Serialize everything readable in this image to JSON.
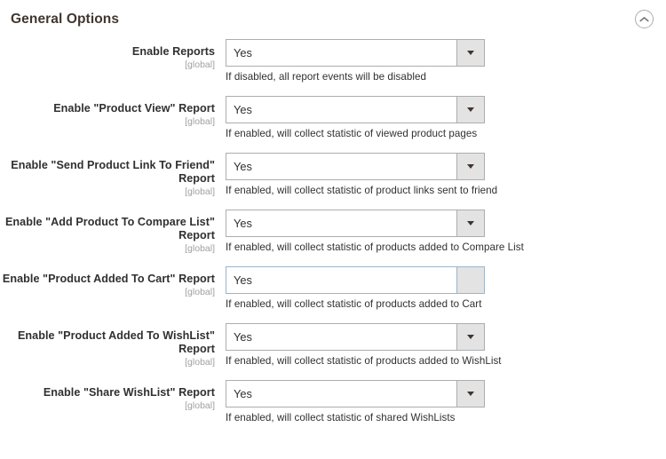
{
  "header": {
    "title": "General Options",
    "collapse_icon": "chevron-up-circle-icon"
  },
  "scope_label": "[global]",
  "dropdown_arrow_icon": "chevron-down-icon",
  "colors": {
    "title": "#41362f",
    "label": "#303030",
    "scope": "#a0a0a0",
    "border": "#adadad",
    "button_face": "#e3e3e3",
    "active_border": "#9cb4c7",
    "background": "#ffffff"
  },
  "fields": [
    {
      "label": "Enable Reports",
      "scope": "[global]",
      "value": "Yes",
      "note": "If disabled, all report events will be disabled",
      "state": "default"
    },
    {
      "label": "Enable \"Product View\" Report",
      "scope": "[global]",
      "value": "Yes",
      "note": "If enabled, will collect statistic of viewed product pages",
      "state": "default"
    },
    {
      "label": "Enable \"Send Product Link To Friend\" Report",
      "scope": "[global]",
      "value": "Yes",
      "note": "If enabled, will collect statistic of product links sent to friend",
      "state": "default"
    },
    {
      "label": "Enable \"Add Product To Compare List\" Report",
      "scope": "[global]",
      "value": "Yes",
      "note": "If enabled, will collect statistic of products added to Compare List",
      "state": "default"
    },
    {
      "label": "Enable \"Product Added To Cart\" Report",
      "scope": "[global]",
      "value": "Yes",
      "note": "If enabled, will collect statistic of products added to Cart",
      "state": "active"
    },
    {
      "label": "Enable \"Product Added To WishList\" Report",
      "scope": "[global]",
      "value": "Yes",
      "note": "If enabled, will collect statistic of products added to WishList",
      "state": "default"
    },
    {
      "label": "Enable \"Share WishList\" Report",
      "scope": "[global]",
      "value": "Yes",
      "note": "If enabled, will collect statistic of shared WishLists",
      "state": "default"
    }
  ]
}
